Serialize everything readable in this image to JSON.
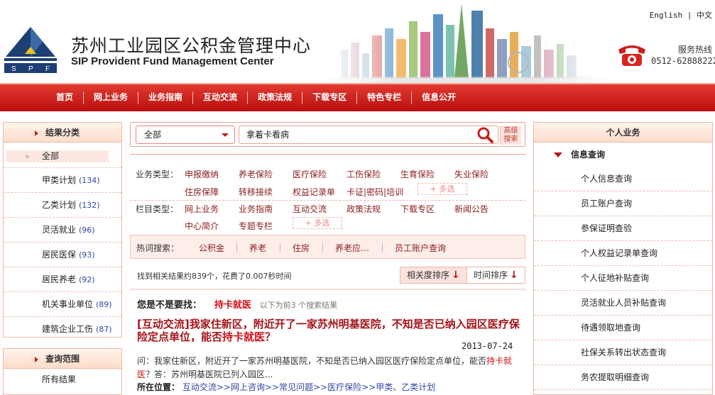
{
  "header": {
    "title_cn": "苏州工业园区公积金管理中心",
    "title_en": "SIP Provident Fund Management Center",
    "lang_en": "English",
    "lang_sep": "|",
    "lang_cn": "中文",
    "hotline_label": "服务热线",
    "hotline_number": "0512-62888222",
    "logo_letters": [
      "S",
      "P",
      "F"
    ]
  },
  "nav": {
    "items": [
      "首页",
      "网上业务",
      "业务指南",
      "互动交流",
      "政策法规",
      "下载专区",
      "特色专栏",
      "信息公开"
    ]
  },
  "left": {
    "results_title": "结果分类",
    "selected_marker": "»",
    "items": [
      {
        "label": "全部",
        "count": ""
      },
      {
        "label": "甲类计划",
        "count": "(134)"
      },
      {
        "label": "乙类计划",
        "count": "(132)"
      },
      {
        "label": "灵活就业",
        "count": "(96)"
      },
      {
        "label": "居民医保",
        "count": "(93)"
      },
      {
        "label": "居民养老",
        "count": "(92)"
      },
      {
        "label": "机关事业单位",
        "count": "(89)"
      },
      {
        "label": "建筑企业工伤",
        "count": "(87)"
      }
    ],
    "scope_title": "查询范围",
    "scope_items": [
      "所有结果"
    ]
  },
  "search": {
    "scope_value": "全部",
    "query": "拿着卡看病",
    "adv_line1": "高级",
    "adv_line2": "搜索"
  },
  "filters": {
    "biz_label": "业务类型：",
    "biz_options": [
      "申报缴纳",
      "养老保险",
      "医疗保险",
      "工伤保险",
      "生育保险",
      "失业保险",
      "住房保障",
      "转移接续",
      "权益记录单",
      "卡证|密码|培训"
    ],
    "col_label": "栏目类型：",
    "col_options": [
      "网上业务",
      "业务指南",
      "互动交流",
      "政策法规",
      "下载专区",
      "新闻公告",
      "中心简介",
      "专题专栏"
    ],
    "multi_label": "+ 多选"
  },
  "hot": {
    "label": "热词搜索：",
    "items": [
      "公积金",
      "养老",
      "住房",
      "养老应…",
      "员工账户查询"
    ]
  },
  "results": {
    "info": "找到相关结果约839个，花费了0.007秒时间",
    "sort_relevance": "相关度排序",
    "sort_time": "时间排序",
    "sort_arrow": "↓",
    "suggest_label": "您是不是要找：",
    "suggest_term": "持卡就医",
    "suggest_note": "以下为前3 个搜索结果",
    "item": {
      "title_a": "[互动交流]我家住新区，附近开了一家苏州明基医院，不知是否已纳入园区医疗保险定点单位，能否",
      "title_hl": "持卡就医",
      "title_b": "？",
      "date": "2013-07-24",
      "snippet_a": "问：我家住新区，附近开了一家苏州明基医院，不知是否已纳入园区医疗保险定点单位，能否",
      "snippet_hl": "持卡就医",
      "snippet_b": "？答：苏州明基医院已列入园区...",
      "location_label": "所在位置：",
      "location_path": "互动交流>>网上咨询>>常见问题>>医疗保险>>甲类、乙类计划"
    }
  },
  "right": {
    "title": "个人业务",
    "sub_title": "信息查询",
    "items": [
      "个人信息查询",
      "员工账户查询",
      "参保证明查验",
      "个人权益记录单查询",
      "个人征地补贴查询",
      "灵活就业人员补贴查询",
      "待遇领取地查询",
      "社保关系转出状态查询",
      "务农提取明细查询"
    ]
  },
  "colors": {
    "nav_red": "#c8201c",
    "accent_red": "#d0111a",
    "link_blue": "#3345a6"
  }
}
